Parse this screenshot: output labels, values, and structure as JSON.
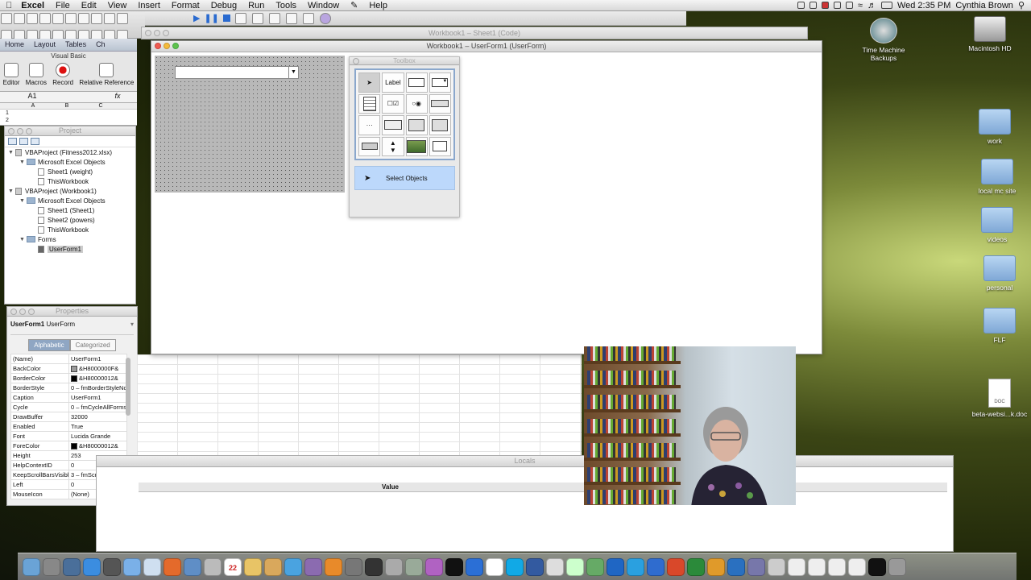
{
  "menubar": {
    "items": [
      "Excel",
      "File",
      "Edit",
      "View",
      "Insert",
      "Format",
      "Debug",
      "Run",
      "Tools",
      "Window",
      "Help"
    ],
    "clock": "Wed 2:35 PM",
    "user": "Cynthia Brown"
  },
  "ribbon": {
    "tabs": [
      "Home",
      "Layout",
      "Tables",
      "Ch"
    ],
    "group": "Visual Basic",
    "buttons": [
      "Editor",
      "Macros",
      "Record",
      "Relative Reference"
    ],
    "name_box": "A1",
    "columns": [
      "A",
      "B",
      "C"
    ],
    "rows": [
      "1",
      "2"
    ]
  },
  "code_window": {
    "title": "Workbook1 – Sheet1 (Code)"
  },
  "userform_window": {
    "title": "Workbook1 – UserForm1 (UserForm)"
  },
  "project": {
    "title": "Project",
    "tree": [
      {
        "label": "VBAProject (Fitness2012.xlsx)",
        "level": 0,
        "kind": "project"
      },
      {
        "label": "Microsoft Excel Objects",
        "level": 1,
        "kind": "folder"
      },
      {
        "label": "Sheet1 (weight)",
        "level": 2,
        "kind": "doc"
      },
      {
        "label": "ThisWorkbook",
        "level": 2,
        "kind": "doc"
      },
      {
        "label": "VBAProject (Workbook1)",
        "level": 0,
        "kind": "project"
      },
      {
        "label": "Microsoft Excel Objects",
        "level": 1,
        "kind": "folder"
      },
      {
        "label": "Sheet1 (Sheet1)",
        "level": 2,
        "kind": "doc"
      },
      {
        "label": "Sheet2 (powers)",
        "level": 2,
        "kind": "doc"
      },
      {
        "label": "ThisWorkbook",
        "level": 2,
        "kind": "doc"
      },
      {
        "label": "Forms",
        "level": 1,
        "kind": "folder"
      },
      {
        "label": "UserForm1",
        "level": 2,
        "kind": "form",
        "selected": true
      }
    ]
  },
  "properties": {
    "title": "Properties",
    "object": "UserForm1",
    "object_type": "UserForm",
    "tabs": [
      "Alphabetic",
      "Categorized"
    ],
    "rows": [
      {
        "name": "(Name)",
        "value": "UserForm1"
      },
      {
        "name": "BackColor",
        "value": "&H8000000F&",
        "swatch": "#9a9a9a"
      },
      {
        "name": "BorderColor",
        "value": "&H80000012&",
        "swatch": "#000000"
      },
      {
        "name": "BorderStyle",
        "value": "0 – fmBorderStyleNone"
      },
      {
        "name": "Caption",
        "value": "UserForm1"
      },
      {
        "name": "Cycle",
        "value": "0 – fmCycleAllForms"
      },
      {
        "name": "DrawBuffer",
        "value": "32000"
      },
      {
        "name": "Enabled",
        "value": "True"
      },
      {
        "name": "Font",
        "value": "Lucida Grande"
      },
      {
        "name": "ForeColor",
        "value": "&H80000012&",
        "swatch": "#000000"
      },
      {
        "name": "Height",
        "value": "253"
      },
      {
        "name": "HelpContextID",
        "value": "0"
      },
      {
        "name": "KeepScrollBarsVisible",
        "value": "3 – fmScrollBarsBoth"
      },
      {
        "name": "Left",
        "value": "0"
      },
      {
        "name": "MouseIcon",
        "value": "(None)"
      }
    ]
  },
  "toolbox": {
    "title": "Toolbox",
    "label_tool": "Label",
    "status": "Select Objects"
  },
  "locals": {
    "title": "Locals",
    "value_header": "Value"
  },
  "desktop": {
    "icons": [
      "Time Machine Backups",
      "Macintosh HD",
      "work",
      "local mc site",
      "videos",
      "personal",
      "FLF",
      "beta-websi...k.doc"
    ],
    "doc_badge": "DOC"
  },
  "dock": {
    "calendar_day": "22"
  }
}
